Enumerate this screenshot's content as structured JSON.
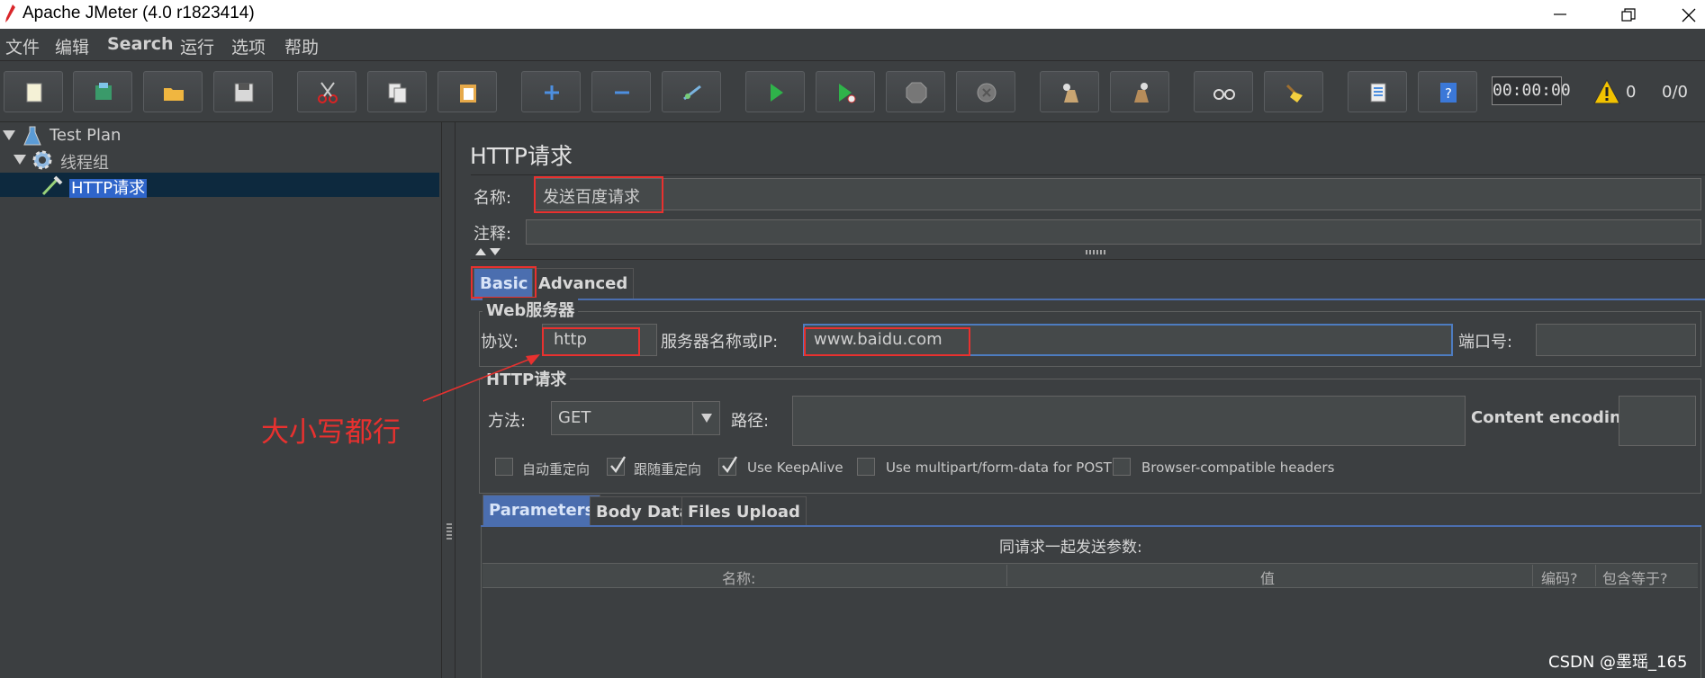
{
  "window": {
    "title": "Apache JMeter (4.0 r1823414)",
    "controls": [
      "minimize-icon",
      "restore-icon",
      "close-icon"
    ]
  },
  "menubar": {
    "items": [
      "文件",
      "编辑",
      "Search",
      "运行",
      "选项",
      "帮助"
    ]
  },
  "toolbar": {
    "buttons": [
      "new-icon",
      "templates-icon",
      "open-icon",
      "save-icon",
      "cut-icon",
      "copy-icon",
      "paste-icon",
      "expand-icon",
      "collapse-icon",
      "toggle-icon",
      "start-icon",
      "start-no-pauses-icon",
      "stop-icon",
      "shutdown-icon",
      "clear-icon",
      "clear-all-icon",
      "search-icon",
      "reset-search-icon",
      "function-helper-icon",
      "help-icon"
    ],
    "timer": "00:00:00",
    "warning_count": "0",
    "threads": "0/0"
  },
  "tree": {
    "items": [
      {
        "label": "Test Plan",
        "icon": "flask-icon"
      },
      {
        "label": "线程组",
        "icon": "gear-icon"
      },
      {
        "label": "HTTP请求",
        "icon": "pipette-icon"
      }
    ]
  },
  "http_request": {
    "panel_title": "HTTP请求",
    "name_label": "名称:",
    "name_value": "发送百度请求",
    "comment_label": "注释:",
    "comment_value": "",
    "tabs": [
      "Basic",
      "Advanced"
    ],
    "web_server": {
      "title": "Web服务器",
      "protocol_label": "协议:",
      "protocol_value": "http",
      "server_label": "服务器名称或IP:",
      "server_value": "www.baidu.com",
      "port_label": "端口号:",
      "port_value": ""
    },
    "http_group": {
      "title": "HTTP请求",
      "method_label": "方法:",
      "method_value": "GET",
      "path_label": "路径:",
      "path_value": "",
      "encoding_label": "Content encoding:",
      "encoding_value": ""
    },
    "checkboxes": [
      {
        "label": "自动重定向",
        "checked": false
      },
      {
        "label": "跟随重定向",
        "checked": true
      },
      {
        "label": "Use KeepAlive",
        "checked": true
      },
      {
        "label": "Use multipart/form-data for POST",
        "checked": false
      },
      {
        "label": "Browser-compatible headers",
        "checked": false
      }
    ],
    "sub_tabs": [
      "Parameters",
      "Body Data",
      "Files Upload"
    ],
    "params_caption": "同请求一起发送参数:",
    "columns": [
      "名称:",
      "值",
      "编码?",
      "包含等于?"
    ]
  },
  "annotation": "大小写都行",
  "watermark": "CSDN @墨瑶_165",
  "colors": {
    "background": "#3c3f41",
    "highlight_red": "#e8312f",
    "selection_blue": "#2f65ca",
    "active_tab": "#4b6eaf"
  }
}
